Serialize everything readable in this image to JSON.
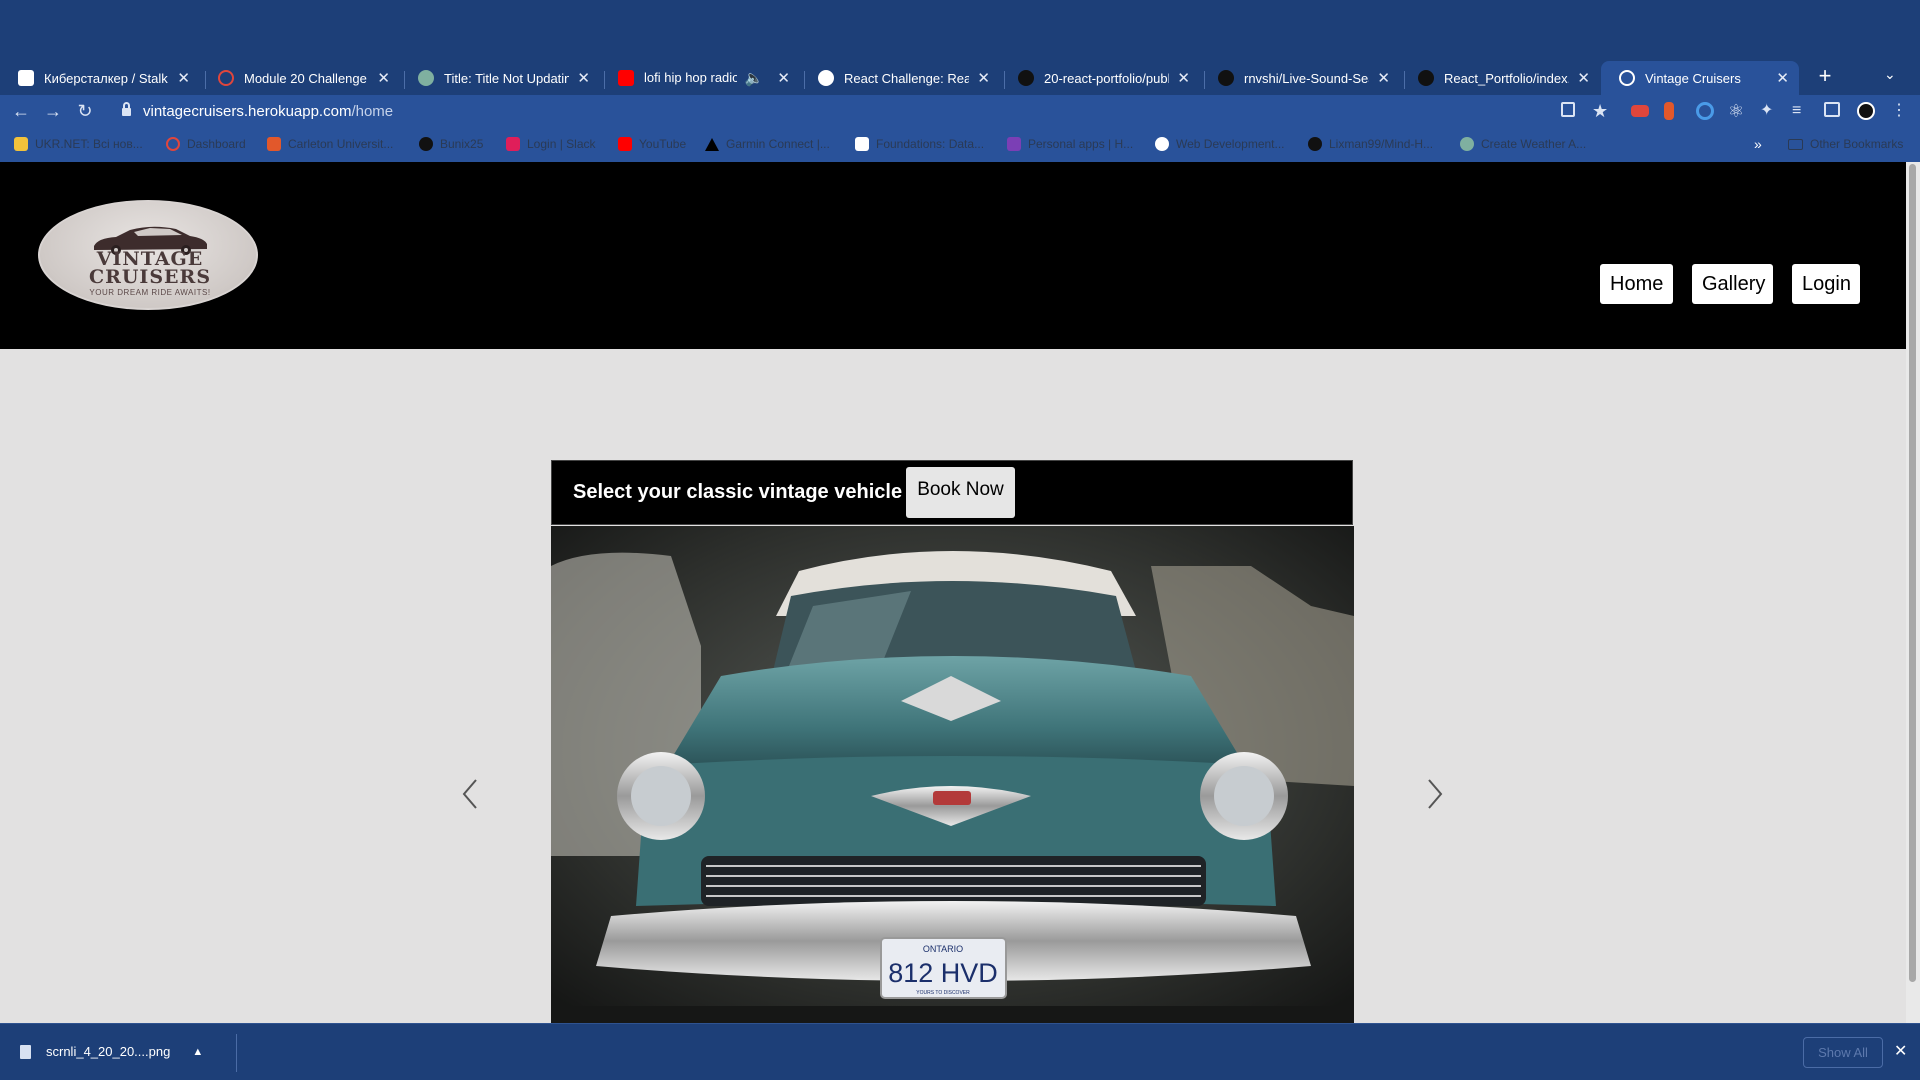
{
  "browser": {
    "tabs": [
      {
        "title": "Киберсталкер / Stalk к",
        "favicon_color": "#ffffff"
      },
      {
        "title": "Module 20 Challenge",
        "favicon_color": "#e0463c"
      },
      {
        "title": "Title: Title Not Updating",
        "favicon_color": "#7fb0a0"
      },
      {
        "title": "lofi hip hop radio 📚",
        "favicon_color": "#ff0000"
      },
      {
        "title": "React Challenge: React",
        "favicon_color": "#ffffff"
      },
      {
        "title": "20-react-portfolio/publ",
        "favicon_color": "#111111"
      },
      {
        "title": "rnvshi/Live-Sound-Sear",
        "favicon_color": "#111111"
      },
      {
        "title": "React_Portfolio/index.js",
        "favicon_color": "#111111"
      },
      {
        "title": "Vintage Cruisers",
        "favicon_color": "#ffffff"
      }
    ],
    "url_host": "vintagecruisers.herokuapp.com",
    "url_path": "/home",
    "bookmarks": [
      {
        "label": "UKR.NET: Всі нов...",
        "color": "#f2c23b"
      },
      {
        "label": "Dashboard",
        "color": "#e0463c"
      },
      {
        "label": "Carleton Universit...",
        "color": "#e2582b"
      },
      {
        "label": "Bunix25",
        "color": "#111111"
      },
      {
        "label": "Login | Slack",
        "color": "#e01e5a"
      },
      {
        "label": "YouTube",
        "color": "#ff0000"
      },
      {
        "label": "Garmin Connect |...",
        "color": "#000000"
      },
      {
        "label": "Foundations: Data...",
        "color": "#ffffff"
      },
      {
        "label": "Personal apps | H...",
        "color": "#7b3fb5"
      },
      {
        "label": "Web Development...",
        "color": "#ffffff"
      },
      {
        "label": "Lixman99/Mind-H...",
        "color": "#111111"
      },
      {
        "label": "Create Weather A...",
        "color": "#7fb0a0"
      }
    ],
    "other_bookmarks": "Other Bookmarks",
    "more_bookmarks": "»"
  },
  "site": {
    "logo": {
      "title": "VINTAGE\nCRUISERS",
      "tagline": "YOUR DREAM RIDE AWAITS!"
    },
    "nav": {
      "home": "Home",
      "gallery": "Gallery",
      "login": "Login"
    },
    "carousel": {
      "caption": "Select your classic vintage vehicle",
      "cta": "Book Now",
      "plate_region": "ONTARIO",
      "plate_number": "812 HVD",
      "plate_motto": "YOURS TO DISCOVER"
    }
  },
  "download_shelf": {
    "file_name": "scrnli_4_20_20....png",
    "show_all": "Show All"
  },
  "colors": {
    "chrome_dark": "#1d3f78",
    "chrome_toolbar": "#29529a",
    "site_header": "#000000",
    "page_bg": "#e2e1e1",
    "car_body": "#4f8a8e"
  }
}
